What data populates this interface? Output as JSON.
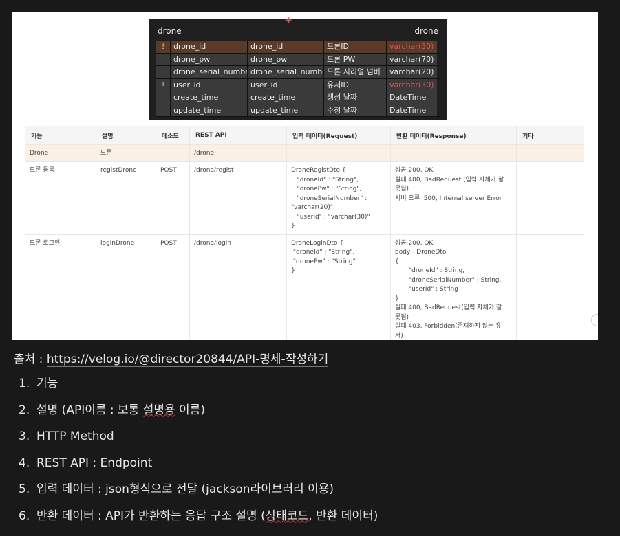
{
  "erd": {
    "table_name_left": "drone",
    "table_name_right": "drone",
    "rows": [
      {
        "key": "pk",
        "physical": "drone_id",
        "logical": "drone_id",
        "kor": "드론ID",
        "type": "varchar(30)",
        "type_red": true
      },
      {
        "key": "",
        "physical": "drone_pw",
        "logical": "drone_pw",
        "kor": "드론 PW",
        "type": "varchar(70)",
        "type_red": false
      },
      {
        "key": "",
        "physical": "drone_serial_number",
        "logical": "drone_serial_number",
        "kor": "드론 시리얼 넘버",
        "type": "varchar(20)",
        "type_red": false
      },
      {
        "key": "fk",
        "physical": "user_id",
        "logical": "user_id",
        "kor": "유저ID",
        "type": "varchar(30)",
        "type_red": true
      },
      {
        "key": "",
        "physical": "create_time",
        "logical": "create_time",
        "kor": "생성 날짜",
        "type": "DateTime",
        "type_red": false
      },
      {
        "key": "",
        "physical": "update_time",
        "logical": "update_time",
        "kor": "수정 날짜",
        "type": "DateTime",
        "type_red": false
      }
    ]
  },
  "api_table": {
    "headers": [
      "기능",
      "설명",
      "메소드",
      "REST API",
      "입력 데이터(Request)",
      "반환 데이터(Response)",
      "기타"
    ],
    "group": {
      "func": "Drone",
      "desc": "드론",
      "method": "",
      "path": "/drone",
      "req": "",
      "res": "",
      "etc": ""
    },
    "rows": [
      {
        "func": "드론 등록",
        "desc": "registDrone",
        "method": "POST",
        "path": "/drone/regist",
        "req": "DroneRegistDto {\n   \"droneId\" : \"String\",\n   \"dronePw\" : \"String\",\n   \"droneSerialNumber\" :\n\"varchar(20)\",\n   \"userId\" : \"varchar(30)\"\n}",
        "res": "성공 200, OK\n실패 400, BadRequest (입력 자체가 잘\n못됨)\n서버 오류  500, Internal server Error",
        "etc": ""
      },
      {
        "func": "드론 로그인",
        "desc": "loginDrone",
        "method": "POST",
        "path": "/drone/login",
        "req": "DroneLoginDto {\n \"droneId\" : \"String\",\n \"dronePw\" : \"String\"\n}",
        "res": "성공 200, OK\nbody - DroneDto\n{\n       \"droneId\" : String,\n       \"droneSerialNumber\" : String,\n       \"userId\" : String\n}\n실패 400, BadRequest(입력 자체가 잘\n못됨)\n실패 403, Forbidden(존재하지 않는 유\n저)",
        "etc": ""
      }
    ]
  },
  "caption": {
    "label": "출처 : ",
    "link": "https://velog.io/@director20844/API-명세-작성하기"
  },
  "list": [
    {
      "num": "1.",
      "parts": [
        {
          "t": "기능"
        }
      ]
    },
    {
      "num": "2.",
      "parts": [
        {
          "t": "설명 (API이름 : 보통 "
        },
        {
          "t": "설명용",
          "spell": true
        },
        {
          "t": " 이름)"
        }
      ]
    },
    {
      "num": "3.",
      "parts": [
        {
          "t": "HTTP Method"
        }
      ]
    },
    {
      "num": "4.",
      "parts": [
        {
          "t": "REST API : Endpoint"
        }
      ]
    },
    {
      "num": "5.",
      "parts": [
        {
          "t": "입력 데이터 : json형식으로 전달 (jackson라이브러리 이용)"
        }
      ]
    },
    {
      "num": "6.",
      "parts": [
        {
          "t": "반환 데이터 : API가 반환하는 응답 구조 설명 ("
        },
        {
          "t": "상태코드",
          "spell": true
        },
        {
          "t": ", 반환 데이터)"
        }
      ]
    }
  ]
}
